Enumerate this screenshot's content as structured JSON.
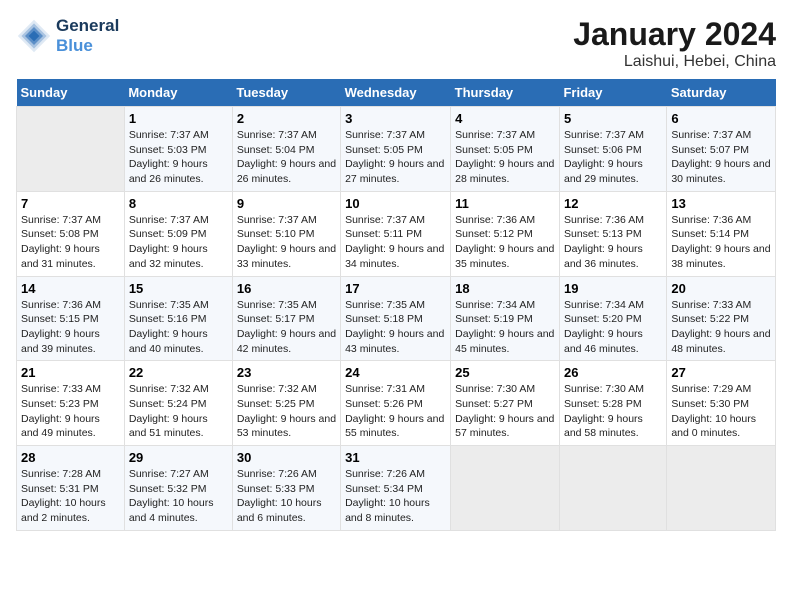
{
  "header": {
    "logo_line1": "General",
    "logo_line2": "Blue",
    "month": "January 2024",
    "location": "Laishui, Hebei, China"
  },
  "weekdays": [
    "Sunday",
    "Monday",
    "Tuesday",
    "Wednesday",
    "Thursday",
    "Friday",
    "Saturday"
  ],
  "weeks": [
    [
      {
        "day": "",
        "sunrise": "",
        "sunset": "",
        "daylight": ""
      },
      {
        "day": "1",
        "sunrise": "Sunrise: 7:37 AM",
        "sunset": "Sunset: 5:03 PM",
        "daylight": "Daylight: 9 hours and 26 minutes."
      },
      {
        "day": "2",
        "sunrise": "Sunrise: 7:37 AM",
        "sunset": "Sunset: 5:04 PM",
        "daylight": "Daylight: 9 hours and 26 minutes."
      },
      {
        "day": "3",
        "sunrise": "Sunrise: 7:37 AM",
        "sunset": "Sunset: 5:05 PM",
        "daylight": "Daylight: 9 hours and 27 minutes."
      },
      {
        "day": "4",
        "sunrise": "Sunrise: 7:37 AM",
        "sunset": "Sunset: 5:05 PM",
        "daylight": "Daylight: 9 hours and 28 minutes."
      },
      {
        "day": "5",
        "sunrise": "Sunrise: 7:37 AM",
        "sunset": "Sunset: 5:06 PM",
        "daylight": "Daylight: 9 hours and 29 minutes."
      },
      {
        "day": "6",
        "sunrise": "Sunrise: 7:37 AM",
        "sunset": "Sunset: 5:07 PM",
        "daylight": "Daylight: 9 hours and 30 minutes."
      }
    ],
    [
      {
        "day": "7",
        "sunrise": "Sunrise: 7:37 AM",
        "sunset": "Sunset: 5:08 PM",
        "daylight": "Daylight: 9 hours and 31 minutes."
      },
      {
        "day": "8",
        "sunrise": "Sunrise: 7:37 AM",
        "sunset": "Sunset: 5:09 PM",
        "daylight": "Daylight: 9 hours and 32 minutes."
      },
      {
        "day": "9",
        "sunrise": "Sunrise: 7:37 AM",
        "sunset": "Sunset: 5:10 PM",
        "daylight": "Daylight: 9 hours and 33 minutes."
      },
      {
        "day": "10",
        "sunrise": "Sunrise: 7:37 AM",
        "sunset": "Sunset: 5:11 PM",
        "daylight": "Daylight: 9 hours and 34 minutes."
      },
      {
        "day": "11",
        "sunrise": "Sunrise: 7:36 AM",
        "sunset": "Sunset: 5:12 PM",
        "daylight": "Daylight: 9 hours and 35 minutes."
      },
      {
        "day": "12",
        "sunrise": "Sunrise: 7:36 AM",
        "sunset": "Sunset: 5:13 PM",
        "daylight": "Daylight: 9 hours and 36 minutes."
      },
      {
        "day": "13",
        "sunrise": "Sunrise: 7:36 AM",
        "sunset": "Sunset: 5:14 PM",
        "daylight": "Daylight: 9 hours and 38 minutes."
      }
    ],
    [
      {
        "day": "14",
        "sunrise": "Sunrise: 7:36 AM",
        "sunset": "Sunset: 5:15 PM",
        "daylight": "Daylight: 9 hours and 39 minutes."
      },
      {
        "day": "15",
        "sunrise": "Sunrise: 7:35 AM",
        "sunset": "Sunset: 5:16 PM",
        "daylight": "Daylight: 9 hours and 40 minutes."
      },
      {
        "day": "16",
        "sunrise": "Sunrise: 7:35 AM",
        "sunset": "Sunset: 5:17 PM",
        "daylight": "Daylight: 9 hours and 42 minutes."
      },
      {
        "day": "17",
        "sunrise": "Sunrise: 7:35 AM",
        "sunset": "Sunset: 5:18 PM",
        "daylight": "Daylight: 9 hours and 43 minutes."
      },
      {
        "day": "18",
        "sunrise": "Sunrise: 7:34 AM",
        "sunset": "Sunset: 5:19 PM",
        "daylight": "Daylight: 9 hours and 45 minutes."
      },
      {
        "day": "19",
        "sunrise": "Sunrise: 7:34 AM",
        "sunset": "Sunset: 5:20 PM",
        "daylight": "Daylight: 9 hours and 46 minutes."
      },
      {
        "day": "20",
        "sunrise": "Sunrise: 7:33 AM",
        "sunset": "Sunset: 5:22 PM",
        "daylight": "Daylight: 9 hours and 48 minutes."
      }
    ],
    [
      {
        "day": "21",
        "sunrise": "Sunrise: 7:33 AM",
        "sunset": "Sunset: 5:23 PM",
        "daylight": "Daylight: 9 hours and 49 minutes."
      },
      {
        "day": "22",
        "sunrise": "Sunrise: 7:32 AM",
        "sunset": "Sunset: 5:24 PM",
        "daylight": "Daylight: 9 hours and 51 minutes."
      },
      {
        "day": "23",
        "sunrise": "Sunrise: 7:32 AM",
        "sunset": "Sunset: 5:25 PM",
        "daylight": "Daylight: 9 hours and 53 minutes."
      },
      {
        "day": "24",
        "sunrise": "Sunrise: 7:31 AM",
        "sunset": "Sunset: 5:26 PM",
        "daylight": "Daylight: 9 hours and 55 minutes."
      },
      {
        "day": "25",
        "sunrise": "Sunrise: 7:30 AM",
        "sunset": "Sunset: 5:27 PM",
        "daylight": "Daylight: 9 hours and 57 minutes."
      },
      {
        "day": "26",
        "sunrise": "Sunrise: 7:30 AM",
        "sunset": "Sunset: 5:28 PM",
        "daylight": "Daylight: 9 hours and 58 minutes."
      },
      {
        "day": "27",
        "sunrise": "Sunrise: 7:29 AM",
        "sunset": "Sunset: 5:30 PM",
        "daylight": "Daylight: 10 hours and 0 minutes."
      }
    ],
    [
      {
        "day": "28",
        "sunrise": "Sunrise: 7:28 AM",
        "sunset": "Sunset: 5:31 PM",
        "daylight": "Daylight: 10 hours and 2 minutes."
      },
      {
        "day": "29",
        "sunrise": "Sunrise: 7:27 AM",
        "sunset": "Sunset: 5:32 PM",
        "daylight": "Daylight: 10 hours and 4 minutes."
      },
      {
        "day": "30",
        "sunrise": "Sunrise: 7:26 AM",
        "sunset": "Sunset: 5:33 PM",
        "daylight": "Daylight: 10 hours and 6 minutes."
      },
      {
        "day": "31",
        "sunrise": "Sunrise: 7:26 AM",
        "sunset": "Sunset: 5:34 PM",
        "daylight": "Daylight: 10 hours and 8 minutes."
      },
      {
        "day": "",
        "sunrise": "",
        "sunset": "",
        "daylight": ""
      },
      {
        "day": "",
        "sunrise": "",
        "sunset": "",
        "daylight": ""
      },
      {
        "day": "",
        "sunrise": "",
        "sunset": "",
        "daylight": ""
      }
    ]
  ]
}
